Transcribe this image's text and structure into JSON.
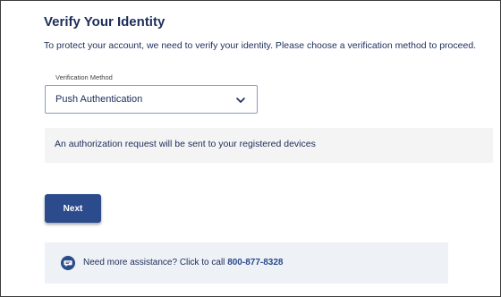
{
  "page": {
    "title": "Verify Your Identity",
    "intro": "To protect your account, we need to verify your identity. Please choose a verification method to proceed."
  },
  "verification": {
    "field_label": "Verification Method",
    "selected_method": "Push Authentication",
    "info_message": "An authorization request will be sent to your registered devices"
  },
  "actions": {
    "next_label": "Next"
  },
  "assistance": {
    "text": "Need more assistance? Click to call ",
    "phone": "800-877-8328"
  },
  "icons": {
    "dropdown": "chevron-down-icon",
    "assistance": "chat-bubble-icon"
  },
  "colors": {
    "primary_text": "#1c2d5a",
    "button_bg": "#2b4b8c",
    "info_bg": "#f4f4f4",
    "assist_bg": "#eef1f5"
  }
}
